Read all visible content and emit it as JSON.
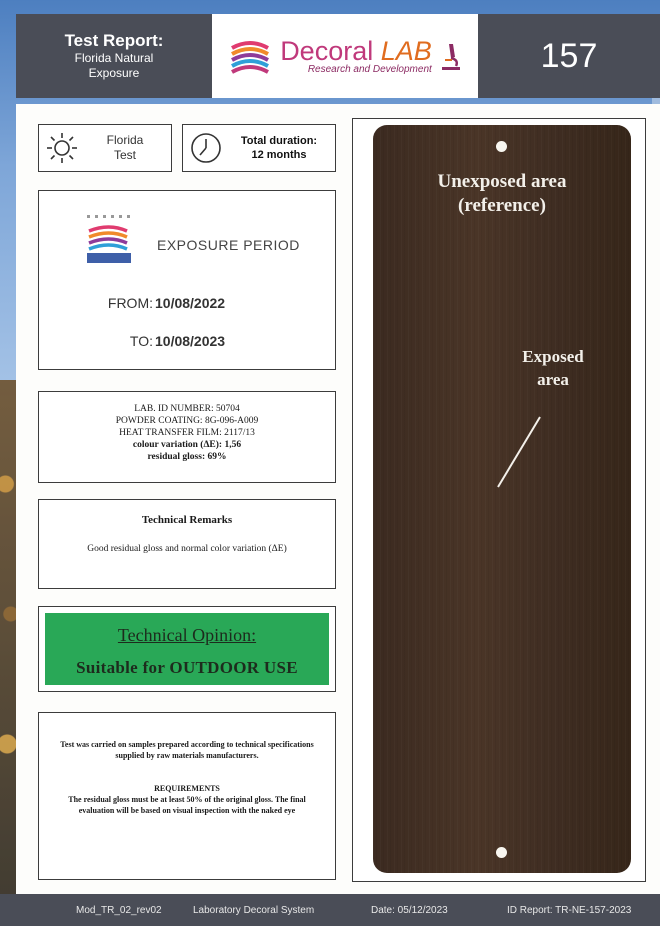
{
  "header": {
    "title": "Test Report:",
    "subtitle_line1": "Florida Natural",
    "subtitle_line2": "Exposure",
    "logo_word1": "Decoral",
    "logo_word2": "LAB",
    "logo_tagline": "Research and Development",
    "report_number": "157"
  },
  "test_type": {
    "line1": "Florida",
    "line2": "Test",
    "icon": "sun-icon"
  },
  "duration": {
    "line1": "Total duration:",
    "line2": "12 months",
    "icon": "clock-icon"
  },
  "exposure_period": {
    "title": "EXPOSURE PERIOD",
    "from_label": "FROM:",
    "from_date": "10/08/2022",
    "to_label": "TO:",
    "to_date": "10/08/2023"
  },
  "lab_info": {
    "lab_id": "LAB. ID NUMBER: 50704",
    "powder_coating": "POWDER COATING: 8G-096-A009",
    "heat_transfer_film": "HEAT TRANSFER FILM: 2117/13",
    "colour_variation": "colour variation (ΔE): 1,56",
    "residual_gloss": "residual gloss: 69%"
  },
  "technical_remarks": {
    "title": "Technical Remarks",
    "text": "Good residual gloss and normal color variation (ΔE)"
  },
  "technical_opinion": {
    "title": "Technical Opinion:",
    "verdict": "Suitable for OUTDOOR USE",
    "color": "#29a857"
  },
  "notes": {
    "text": "Test was carried on samples prepared according to technical specifications supplied by raw materials manufacturers.",
    "requirements_title": "REQUIREMENTS",
    "requirements_text": "The residual gloss must be at least 50% of the original gloss. The final evaluation will be based on visual inspection with the naked eye"
  },
  "sample_panel": {
    "unexposed_line1": "Unexposed area",
    "unexposed_line2": "(reference)",
    "exposed_line1": "Exposed",
    "exposed_line2": "area"
  },
  "footer": {
    "module": "Mod_TR_02_rev02",
    "system": "Laboratory Decoral System",
    "date": "Date: 05/12/2023",
    "report_id": "ID Report: TR-NE-157-2023"
  }
}
